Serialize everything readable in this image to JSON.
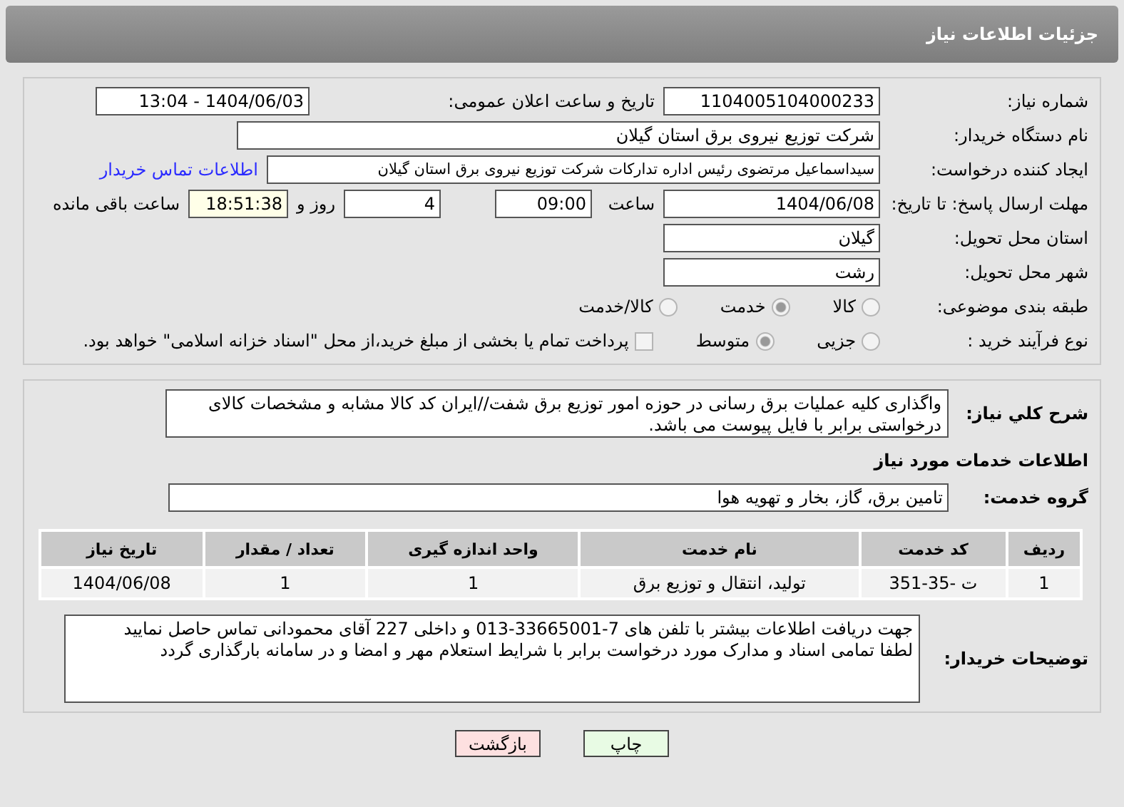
{
  "header": {
    "title": "جزئیات اطلاعات نیاز"
  },
  "details": {
    "need_number": {
      "label": "شماره نیاز:",
      "value": "1104005104000233"
    },
    "announce": {
      "label": "تاریخ و ساعت اعلان عمومی:",
      "value": "1404/06/03 - 13:04"
    },
    "buyer": {
      "label": "نام دستگاه خریدار:",
      "value": "شرکت توزیع نیروی برق استان گیلان"
    },
    "creator": {
      "label": "ایجاد کننده درخواست:",
      "value": "سیداسماعیل مرتضوی رئیس اداره تدارکات شرکت توزیع نیروی برق استان گیلان",
      "link": "اطلاعات تماس خریدار"
    },
    "deadline": {
      "label": "مهلت ارسال پاسخ: تا تاریخ:",
      "date": "1404/06/08",
      "time_label": "ساعت",
      "time": "09:00",
      "days": "4",
      "days_label": "روز و",
      "remaining": "18:51:38",
      "remaining_label": "ساعت باقی مانده"
    },
    "province": {
      "label": "استان محل تحویل:",
      "value": "گیلان"
    },
    "city": {
      "label": "شهر محل تحویل:",
      "value": "رشت"
    },
    "category": {
      "label": "طبقه بندی موضوعی:",
      "options": [
        {
          "label": "کالا",
          "selected": false
        },
        {
          "label": "خدمت",
          "selected": true
        },
        {
          "label": "کالا/خدمت",
          "selected": false
        }
      ]
    },
    "process": {
      "label": "نوع فرآیند خرید :",
      "options": [
        {
          "label": "جزیی",
          "selected": false
        },
        {
          "label": "متوسط",
          "selected": true
        }
      ],
      "payment": {
        "label": "پرداخت تمام یا بخشی از مبلغ خرید،از محل \"اسناد خزانه اسلامی\" خواهد بود.",
        "checked": false
      }
    }
  },
  "description": {
    "label": "شرح کلي نياز:",
    "value": "واگذاری کلیه عملیات برق رسانی در حوزه امور توزیع برق شفت//ایران کد کالا مشابه و مشخصات کالای درخواستی برابر با فایل پیوست می باشد."
  },
  "services": {
    "heading": "اطلاعات خدمات مورد نیاز",
    "group_label": "گروه خدمت:",
    "group": "تامین برق، گاز، بخار و تهویه هوا",
    "table": {
      "columns": [
        "ردیف",
        "کد خدمت",
        "نام خدمت",
        "واحد اندازه گیری",
        "تعداد / مقدار",
        "تاریخ نیاز"
      ],
      "rows": [
        [
          "1",
          "ت -35-351",
          "تولید، انتقال و توزیع برق",
          "1",
          "1",
          "1404/06/08"
        ]
      ]
    }
  },
  "notes": {
    "label": "توضیحات خریدار:",
    "lines": [
      "جهت دریافت اطلاعات بیشتر با تلفن های 7-33665001-013 و داخلی 227 آقای محمودانی تماس حاصل نمایید",
      "لطفا تمامی اسناد و مدارک مورد درخواست برابر با شرایط استعلام مهر و امضا و در سامانه بارگذاری گردد"
    ]
  },
  "buttons": [
    {
      "label": "چاپ",
      "kind": "print"
    },
    {
      "label": "بازگشت",
      "kind": "back"
    }
  ]
}
